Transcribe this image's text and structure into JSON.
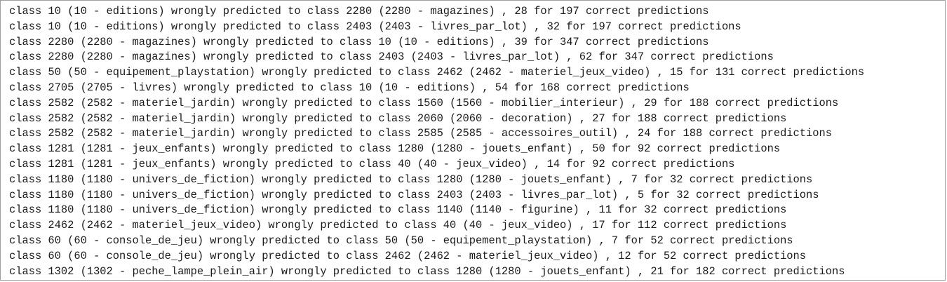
{
  "output": {
    "lines": [
      "class 10 (10 - editions) wrongly predicted to class 2280 (2280 - magazines) , 28 for 197 correct predictions",
      "class 10 (10 - editions) wrongly predicted to class 2403 (2403 - livres_par_lot) , 32 for 197 correct predictions",
      "class 2280 (2280 - magazines) wrongly predicted to class 10 (10 - editions) , 39 for 347 correct predictions",
      "class 2280 (2280 - magazines) wrongly predicted to class 2403 (2403 - livres_par_lot) , 62 for 347 correct predictions",
      "class 50 (50 - equipement_playstation) wrongly predicted to class 2462 (2462 - materiel_jeux_video) , 15 for 131 correct predictions",
      "class 2705 (2705 - livres) wrongly predicted to class 10 (10 - editions) , 54 for 168 correct predictions",
      "class 2582 (2582 - materiel_jardin) wrongly predicted to class 1560 (1560 - mobilier_interieur) , 29 for 188 correct predictions",
      "class 2582 (2582 - materiel_jardin) wrongly predicted to class 2060 (2060 - decoration) , 27 for 188 correct predictions",
      "class 2582 (2582 - materiel_jardin) wrongly predicted to class 2585 (2585 - accessoires_outil) , 24 for 188 correct predictions",
      "class 1281 (1281 - jeux_enfants) wrongly predicted to class 1280 (1280 - jouets_enfant) , 50 for 92 correct predictions",
      "class 1281 (1281 - jeux_enfants) wrongly predicted to class 40 (40 - jeux_video) , 14 for 92 correct predictions",
      "class 1180 (1180 - univers_de_fiction) wrongly predicted to class 1280 (1280 - jouets_enfant) , 7 for 32 correct predictions",
      "class 1180 (1180 - univers_de_fiction) wrongly predicted to class 2403 (2403 - livres_par_lot) , 5 for 32 correct predictions",
      "class 1180 (1180 - univers_de_fiction) wrongly predicted to class 1140 (1140 - figurine) , 11 for 32 correct predictions",
      "class 2462 (2462 - materiel_jeux_video) wrongly predicted to class 40 (40 - jeux_video) , 17 for 112 correct predictions",
      "class 60 (60 - console_de_jeu) wrongly predicted to class 50 (50 - equipement_playstation) , 7 for 52 correct predictions",
      "class 60 (60 - console_de_jeu) wrongly predicted to class 2462 (2462 - materiel_jeux_video) , 12 for 52 correct predictions",
      "class 1302 (1302 - peche_lampe_plein_air) wrongly predicted to class 1280 (1280 - jouets_enfant) , 21 for 182 correct predictions"
    ]
  }
}
